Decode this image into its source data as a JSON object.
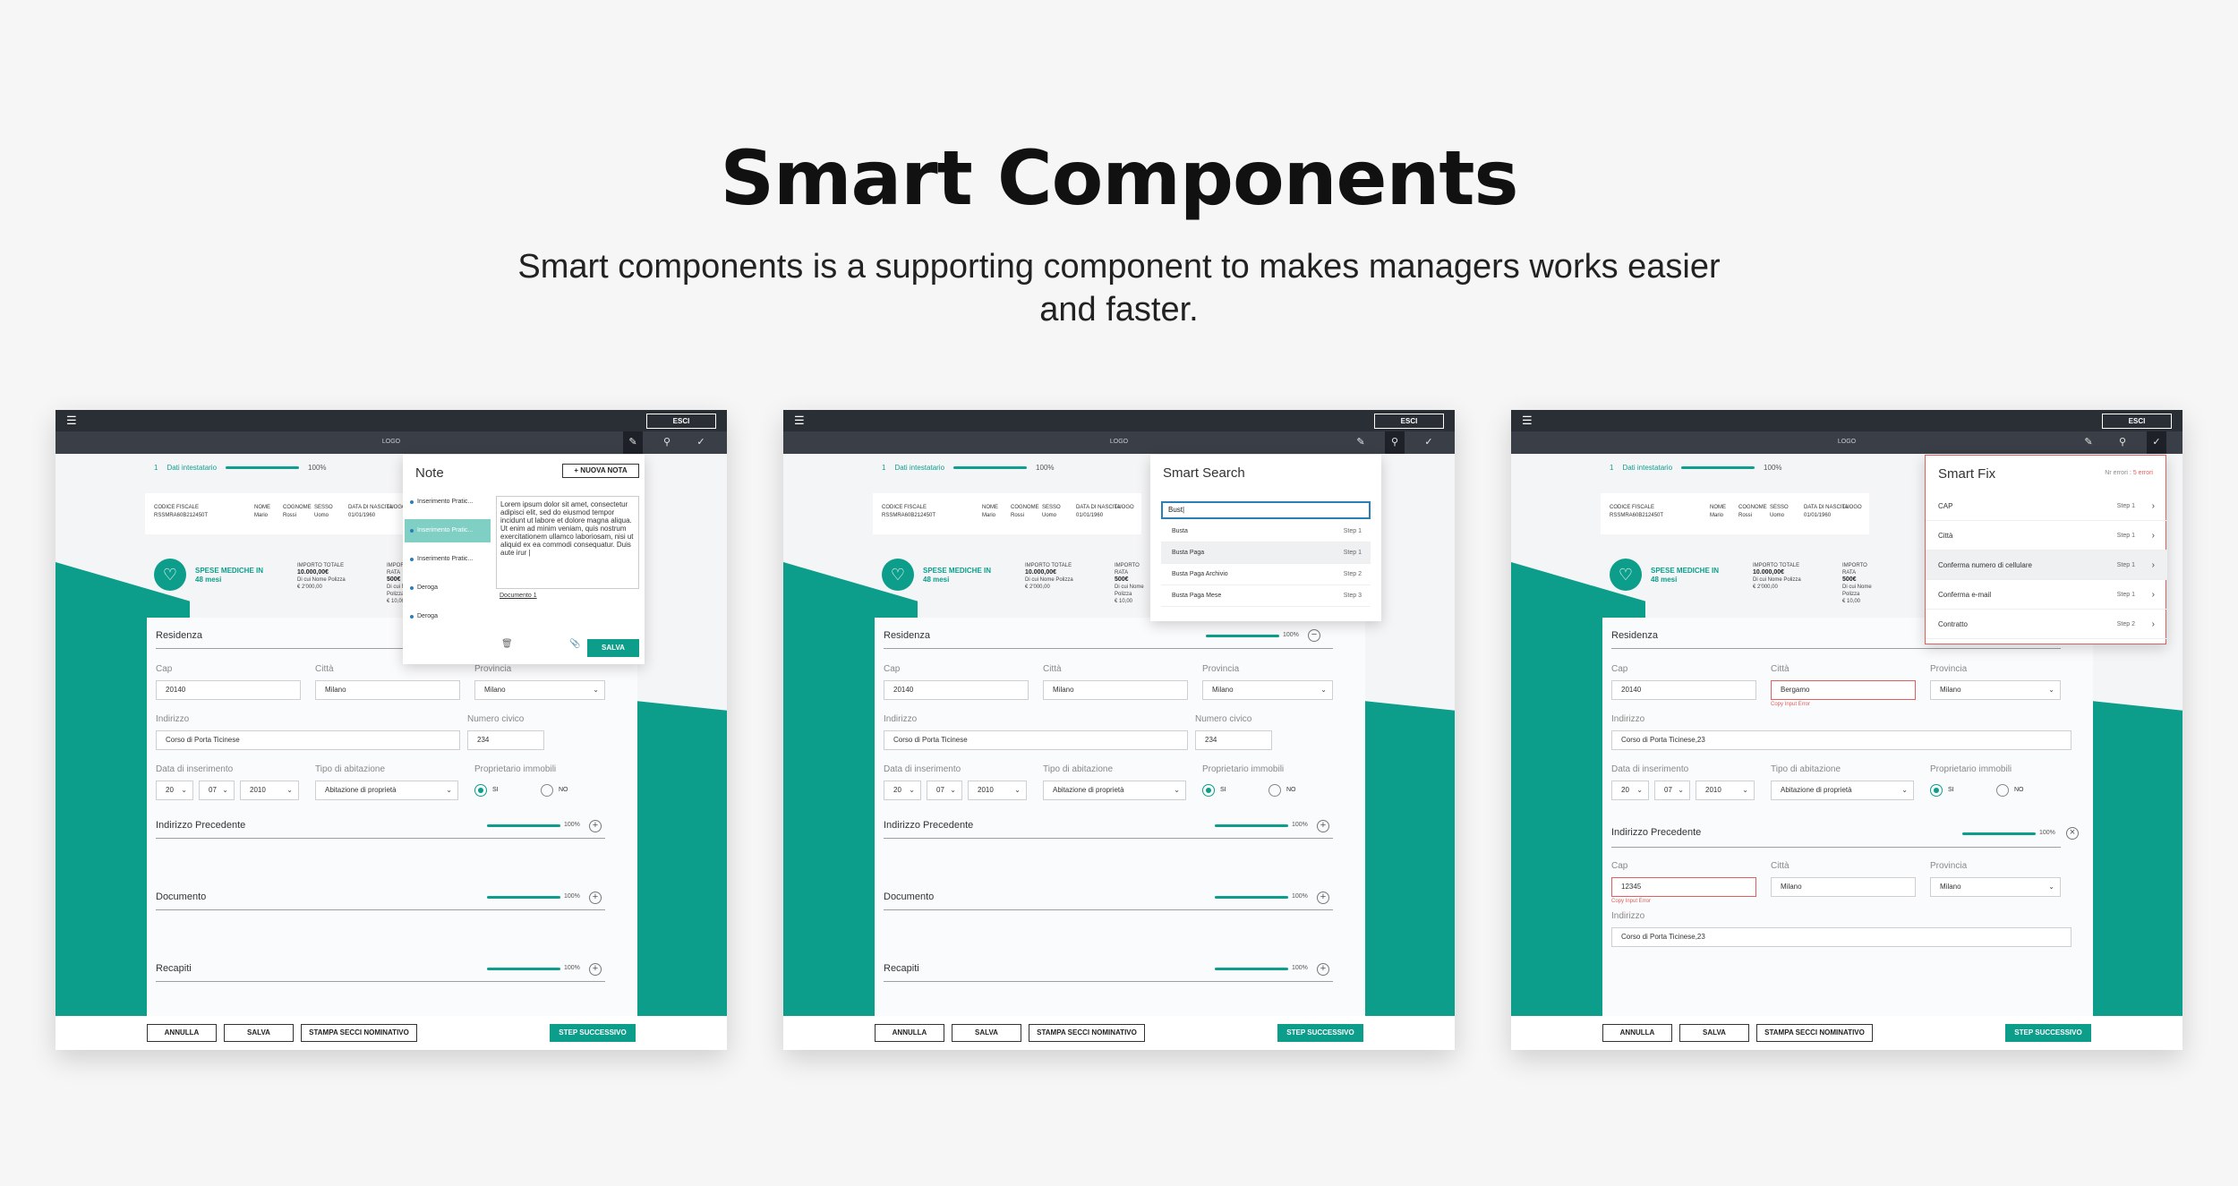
{
  "hero": {
    "title": "Smart Components",
    "subtitle": "Smart components is a supporting component to makes managers works easier and faster."
  },
  "app": {
    "esci": "ESCI",
    "logo": "LOGO",
    "step_number": "1",
    "step_label": "Dati intestatario",
    "step_pct": "100%",
    "holder": {
      "cf_label": "CODICE FISCALE",
      "cf_value": "RSSMRA60B212450T",
      "nome_label": "NOME",
      "nome_value": "Mario",
      "cognome_label": "COGNOME",
      "cognome_value": "Rossi",
      "sesso_label": "SESSO",
      "sesso_value": "Uomo",
      "nascita_label": "DATA DI NASCITA",
      "nascita_value": "01/01/1960",
      "luogo_label": "LUOGO"
    },
    "spese": {
      "label_line1": "SPESE MEDICHE IN",
      "label_line2": "48 mesi",
      "importo_totale_label": "IMPORTO TOTALE",
      "importo_totale_value": "10.000,00€",
      "importo_totale_note1": "Di cui Nome Polizza",
      "importo_totale_note2": "€ 2'000,00",
      "importo_rata_label": "IMPORTO RATA",
      "importo_rata_value": "500€",
      "importo_rata_note1": "Di cui Nome Polizza",
      "importo_rata_note2": "€ 10,00"
    },
    "residenza": {
      "title": "Residenza",
      "pct": "100%",
      "cap_label": "Cap",
      "cap_value": "20140",
      "citta_label": "Città",
      "citta_value": "Milano",
      "citta_value_err": "Bergamo",
      "provincia_label": "Provincia",
      "provincia_value": "Milano",
      "indirizzo_label": "Indirizzo",
      "indirizzo_value": "Corso di Porta Ticinese",
      "indirizzo_value_alt": "Corso di Porta Ticinese,23",
      "civico_label": "Numero civico",
      "civico_value": "234",
      "data_label": "Data di inserimento",
      "day": "20",
      "month": "07",
      "year": "2010",
      "tipo_label": "Tipo di abitazione",
      "tipo_value": "Abitazione di proprietà",
      "prop_label": "Proprietario immobili",
      "si": "SI",
      "no": "NO",
      "error_msg": "Copy Input Error"
    },
    "sections": [
      {
        "title": "Indirizzo Precedente",
        "pct": "100%"
      },
      {
        "title": "Documento",
        "pct": "100%"
      },
      {
        "title": "Recapiti",
        "pct": "100%"
      }
    ],
    "precedente": {
      "cap_value": "12345",
      "citta_value": "Milano",
      "provincia_value": "Milano",
      "indirizzo_value": "Corso di Porta Ticinese,23"
    },
    "bottom": {
      "annulla": "ANNULLA",
      "salva": "SALVA",
      "stampa": "STAMPA SECCI NOMINATIVO",
      "next": "STEP SUCCESSIVO"
    }
  },
  "note_popup": {
    "title": "Note",
    "new_button": "+ NUOVA NOTA",
    "items": [
      {
        "label": "Inserimento Pratic...",
        "selected": false
      },
      {
        "label": "Inserimento Pratic...",
        "selected": true
      },
      {
        "label": "Inserimento Pratic...",
        "selected": false
      },
      {
        "label": "Deroga",
        "selected": false
      },
      {
        "label": "Deroga",
        "selected": false
      }
    ],
    "text": "Lorem ipsum dolor sit amet, consectetur adipisci elit, sed do eiusmod tempor incidunt ut labore et dolore magna aliqua. Ut enim ad minim veniam, quis nostrum exercitationem ullamco laboriosam, nisi ut aliquid ex ea commodi consequatur. Duis aute irur |",
    "document": "Documento 1",
    "save": "SALVA"
  },
  "search_popup": {
    "title": "Smart Search",
    "query": "Bust|",
    "results": [
      {
        "label": "Busta",
        "step": "Step 1"
      },
      {
        "label": "Busta Paga",
        "step": "Step 1"
      },
      {
        "label": "Busta Paga Archivio",
        "step": "Step 2"
      },
      {
        "label": "Busta Paga Mese",
        "step": "Step 3"
      }
    ]
  },
  "fix_popup": {
    "title": "Smart Fix",
    "errors_label": "Nr errori :",
    "errors_value": "5 errori",
    "items": [
      {
        "label": "CAP",
        "step": "Step 1"
      },
      {
        "label": "Città",
        "step": "Step 1"
      },
      {
        "label": "Conferma numero di cellulare",
        "step": "Step 1"
      },
      {
        "label": "Conferma e-mail",
        "step": "Step 1"
      },
      {
        "label": "Contratto",
        "step": "Step 2"
      }
    ]
  },
  "colors": {
    "accent": "#0c9d8b",
    "topbar": "#2a2e35",
    "error": "#e06060",
    "focus": "#2a7fb8"
  }
}
